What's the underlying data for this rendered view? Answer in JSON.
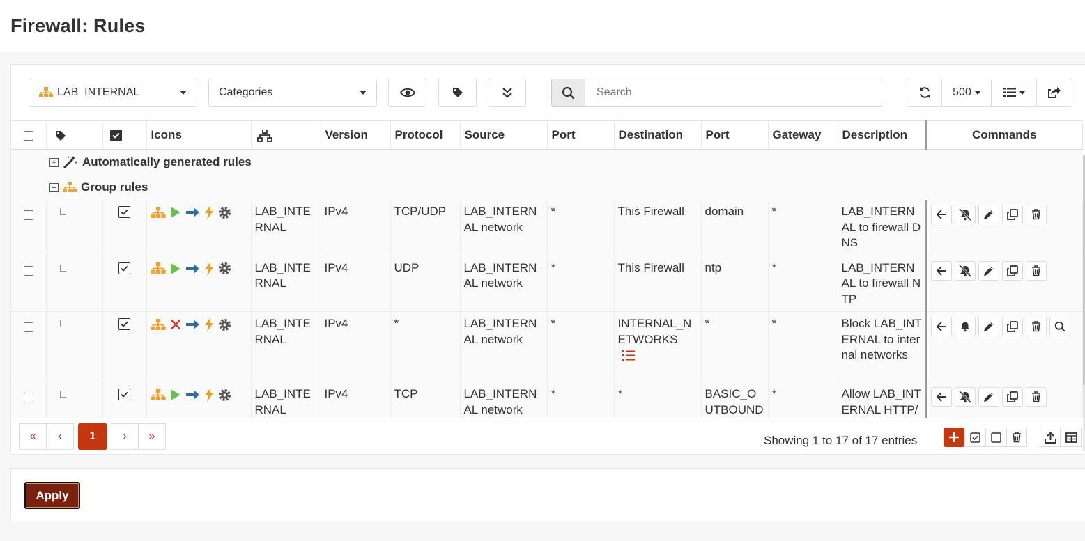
{
  "page": {
    "title": "Firewall: Rules"
  },
  "toolbar": {
    "interface_select": "LAB_INTERNAL",
    "categories_select": "Categories",
    "search_placeholder": "Search",
    "page_size": "500"
  },
  "columns": {
    "icons": "Icons",
    "version": "Version",
    "protocol": "Protocol",
    "source": "Source",
    "source_port": "Port",
    "destination": "Destination",
    "destination_port": "Port",
    "gateway": "Gateway",
    "description": "Description",
    "commands": "Commands"
  },
  "groups": {
    "auto": "Automatically generated rules",
    "group": "Group rules"
  },
  "rules": [
    {
      "interface": "LAB_INTERNAL",
      "version": "IPv4",
      "protocol": "TCP/UDP",
      "source": "LAB_INTERNAL network",
      "source_port": "*",
      "destination": "This Firewall",
      "destination_port": "domain",
      "gateway": "*",
      "description": "LAB_INTERNAL to firewall DNS",
      "action": "pass"
    },
    {
      "interface": "LAB_INTERNAL",
      "version": "IPv4",
      "protocol": "UDP",
      "source": "LAB_INTERNAL network",
      "source_port": "*",
      "destination": "This Firewall",
      "destination_port": "ntp",
      "gateway": "*",
      "description": "LAB_INTERNAL to firewall NTP",
      "action": "pass"
    },
    {
      "interface": "LAB_INTERNAL",
      "version": "IPv4",
      "protocol": "*",
      "source": "LAB_INTERNAL network",
      "source_port": "*",
      "destination": "INTERNAL_NETWORKS",
      "destination_port": "*",
      "gateway": "*",
      "description": "Block LAB_INTERNAL to internal networks",
      "action": "block"
    },
    {
      "interface": "LAB_INTERNAL",
      "version": "IPv4",
      "protocol": "TCP",
      "source": "LAB_INTERNAL network",
      "source_port": "*",
      "destination": "*",
      "destination_port": "BASIC_OUTBOUND_TCP",
      "gateway": "*",
      "description": "Allow LAB_INTERNAL HTTP/HTTPS",
      "action": "pass"
    }
  ],
  "footer": {
    "first": "«",
    "prev": "‹",
    "page": "1",
    "next": "›",
    "last": "»",
    "showing": "Showing 1 to 17 of 17 entries"
  },
  "apply": {
    "label": "Apply"
  },
  "colors": {
    "accent": "#c4370f",
    "interface_icon": "#e8a23a",
    "pass": "#6cbf4f",
    "block": "#d9342b",
    "direction": "#2f6f99",
    "quick": "#f0a020",
    "apply": "#7a220f"
  }
}
